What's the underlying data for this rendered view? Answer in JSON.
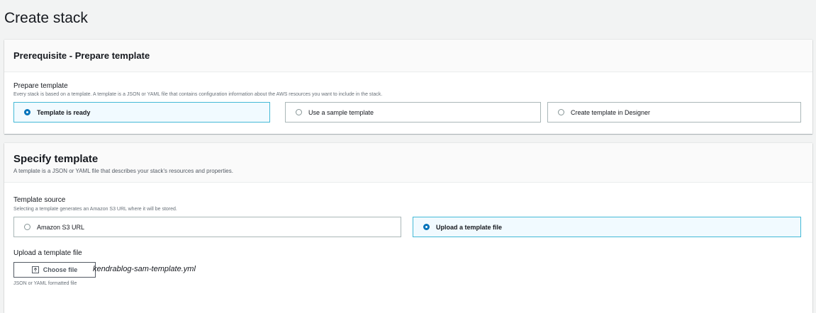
{
  "page": {
    "title": "Create stack"
  },
  "prerequisite": {
    "heading": "Prerequisite - Prepare template",
    "label": "Prepare template",
    "description": "Every stack is based on a template. A template is a JSON or YAML file that contains configuration information about the AWS resources you want to include in the stack.",
    "options": [
      {
        "label": "Template is ready",
        "selected": true
      },
      {
        "label": "Use a sample template",
        "selected": false
      },
      {
        "label": "Create template in Designer",
        "selected": false
      }
    ]
  },
  "specify": {
    "heading": "Specify template",
    "description": "A template is a JSON or YAML file that describes your stack's resources and properties.",
    "source_label": "Template source",
    "source_description": "Selecting a template generates an Amazon S3 URL where it will be stored.",
    "options": [
      {
        "label": "Amazon S3 URL",
        "selected": false
      },
      {
        "label": "Upload a template file",
        "selected": true
      }
    ],
    "upload_label": "Upload a template file",
    "choose_file_label": "Choose file",
    "file_name": "kendrablog-sam-template.yml",
    "file_hint": "JSON or YAML formatted file"
  },
  "colors": {
    "accent": "#0073bb",
    "selected_border": "#44b9d6",
    "selected_bg": "#f1faff"
  }
}
